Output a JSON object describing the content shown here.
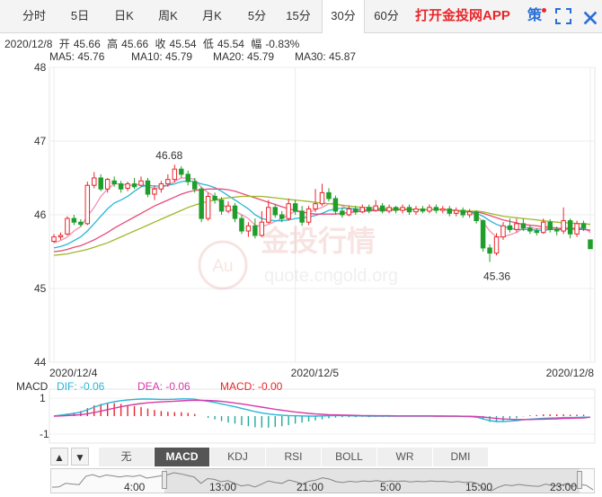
{
  "tabs": [
    {
      "label": "分时"
    },
    {
      "label": "5日"
    },
    {
      "label": "日K"
    },
    {
      "label": "周K"
    },
    {
      "label": "月K"
    },
    {
      "label": "5分"
    },
    {
      "label": "15分"
    },
    {
      "label": "30分",
      "active": true
    },
    {
      "label": "60分"
    }
  ],
  "app_link": "打开金投网APP",
  "strategy_label": "策",
  "fullscreen_icon": "expand-icon",
  "info": {
    "date": "2020/12/8",
    "open_label": "开",
    "open": "45.66",
    "high_label": "高",
    "high": "45.66",
    "close_label": "收",
    "close": "45.54",
    "low_label": "低",
    "low": "45.54",
    "change_label": "幅",
    "change": "-0.83%"
  },
  "ma_legend": [
    {
      "text": "MA5: 45.76",
      "color": "#f48fb1"
    },
    {
      "text": "MA10: 45.79",
      "color": "#29b6d6"
    },
    {
      "text": "MA20: 45.79",
      "color": "#e84c7a"
    },
    {
      "text": "MA30: 45.87",
      "color": "#a0b82a"
    }
  ],
  "watermark": {
    "brand": "金投行情",
    "logo": "Au",
    "url": "quote.cngold.org"
  },
  "macd_legend": {
    "name": "MACD",
    "dif": "DIF: -0.06",
    "dea": "DEA: -0.06",
    "macd": "MACD: -0.00"
  },
  "controls": {
    "prev": "▲",
    "next": "▼"
  },
  "indicators": [
    {
      "label": "无"
    },
    {
      "label": "MACD",
      "active": true
    },
    {
      "label": "KDJ"
    },
    {
      "label": "RSI"
    },
    {
      "label": "BOLL"
    },
    {
      "label": "WR"
    },
    {
      "label": "DMI"
    }
  ],
  "navigator": {
    "ticks": [
      "4:00",
      "13:00",
      "21:00",
      "5:00",
      "15:00",
      "23:00"
    ]
  },
  "colors": {
    "up": "#e8262b",
    "down": "#1f9e2c",
    "dif": "#29b6d6",
    "dea": "#d63aa8"
  },
  "chart_data": {
    "type": "candlestick",
    "title": "",
    "y_axis_ticks": [
      "48",
      "47",
      "46",
      "45",
      "44"
    ],
    "ylim": [
      44,
      48
    ],
    "x_labels": [
      "2020/12/4",
      "2020/12/5",
      "2020/12/8"
    ],
    "annotations": [
      {
        "text": "46.68",
        "kind": "high"
      },
      {
        "text": "45.36",
        "kind": "low"
      }
    ],
    "candles": [
      {
        "o": 45.64,
        "c": 45.7,
        "h": 45.74,
        "l": 45.62
      },
      {
        "o": 45.7,
        "c": 45.72,
        "h": 45.76,
        "l": 45.66
      },
      {
        "o": 45.74,
        "c": 45.95,
        "h": 45.98,
        "l": 45.72
      },
      {
        "o": 45.95,
        "c": 45.9,
        "h": 46.0,
        "l": 45.86
      },
      {
        "o": 45.9,
        "c": 45.87,
        "h": 45.94,
        "l": 45.84
      },
      {
        "o": 45.88,
        "c": 46.4,
        "h": 46.45,
        "l": 45.86
      },
      {
        "o": 46.4,
        "c": 46.5,
        "h": 46.58,
        "l": 46.36
      },
      {
        "o": 46.5,
        "c": 46.35,
        "h": 46.55,
        "l": 46.32
      },
      {
        "o": 46.35,
        "c": 46.48,
        "h": 46.5,
        "l": 46.3
      },
      {
        "o": 46.46,
        "c": 46.42,
        "h": 46.52,
        "l": 46.38
      },
      {
        "o": 46.42,
        "c": 46.35,
        "h": 46.46,
        "l": 46.3
      },
      {
        "o": 46.36,
        "c": 46.42,
        "h": 46.45,
        "l": 46.32
      },
      {
        "o": 46.42,
        "c": 46.38,
        "h": 46.5,
        "l": 46.35
      },
      {
        "o": 46.4,
        "c": 46.46,
        "h": 46.52,
        "l": 46.38
      },
      {
        "o": 46.46,
        "c": 46.28,
        "h": 46.5,
        "l": 46.24
      },
      {
        "o": 46.28,
        "c": 46.35,
        "h": 46.4,
        "l": 46.2
      },
      {
        "o": 46.35,
        "c": 46.42,
        "h": 46.46,
        "l": 46.3
      },
      {
        "o": 46.42,
        "c": 46.48,
        "h": 46.55,
        "l": 46.38
      },
      {
        "o": 46.48,
        "c": 46.62,
        "h": 46.68,
        "l": 46.44
      },
      {
        "o": 46.62,
        "c": 46.55,
        "h": 46.66,
        "l": 46.5
      },
      {
        "o": 46.55,
        "c": 46.45,
        "h": 46.6,
        "l": 46.4
      },
      {
        "o": 46.45,
        "c": 46.35,
        "h": 46.5,
        "l": 46.3
      },
      {
        "o": 46.35,
        "c": 45.95,
        "h": 46.38,
        "l": 45.9
      },
      {
        "o": 45.95,
        "c": 46.25,
        "h": 46.3,
        "l": 45.92
      },
      {
        "o": 46.25,
        "c": 46.2,
        "h": 46.3,
        "l": 46.15
      },
      {
        "o": 46.2,
        "c": 46.05,
        "h": 46.24,
        "l": 46.0
      },
      {
        "o": 46.05,
        "c": 46.12,
        "h": 46.18,
        "l": 46.02
      },
      {
        "o": 46.12,
        "c": 45.95,
        "h": 46.16,
        "l": 45.9
      },
      {
        "o": 45.95,
        "c": 45.78,
        "h": 46.0,
        "l": 45.74
      },
      {
        "o": 45.78,
        "c": 45.85,
        "h": 45.9,
        "l": 45.7
      },
      {
        "o": 45.85,
        "c": 45.72,
        "h": 45.95,
        "l": 45.68
      },
      {
        "o": 45.72,
        "c": 45.9,
        "h": 46.05,
        "l": 45.7
      },
      {
        "o": 45.9,
        "c": 46.1,
        "h": 46.2,
        "l": 45.88
      },
      {
        "o": 46.1,
        "c": 46.0,
        "h": 46.15,
        "l": 45.96
      },
      {
        "o": 46.0,
        "c": 45.95,
        "h": 46.05,
        "l": 45.9
      },
      {
        "o": 45.95,
        "c": 46.15,
        "h": 46.22,
        "l": 45.92
      },
      {
        "o": 46.15,
        "c": 46.05,
        "h": 46.2,
        "l": 46.0
      },
      {
        "o": 46.05,
        "c": 45.9,
        "h": 46.12,
        "l": 45.85
      },
      {
        "o": 45.9,
        "c": 46.08,
        "h": 46.12,
        "l": 45.86
      },
      {
        "o": 46.08,
        "c": 46.15,
        "h": 46.35,
        "l": 46.04
      },
      {
        "o": 46.15,
        "c": 46.3,
        "h": 46.42,
        "l": 46.12
      },
      {
        "o": 46.3,
        "c": 46.22,
        "h": 46.36,
        "l": 46.18
      },
      {
        "o": 46.22,
        "c": 46.05,
        "h": 46.26,
        "l": 46.0
      },
      {
        "o": 46.05,
        "c": 46.0,
        "h": 46.1,
        "l": 45.96
      },
      {
        "o": 46.0,
        "c": 46.08,
        "h": 46.12,
        "l": 45.98
      },
      {
        "o": 46.08,
        "c": 46.04,
        "h": 46.12,
        "l": 46.0
      },
      {
        "o": 46.04,
        "c": 46.1,
        "h": 46.14,
        "l": 46.02
      },
      {
        "o": 46.1,
        "c": 46.06,
        "h": 46.14,
        "l": 46.02
      },
      {
        "o": 46.06,
        "c": 46.12,
        "h": 46.2,
        "l": 46.04
      },
      {
        "o": 46.12,
        "c": 46.05,
        "h": 46.16,
        "l": 46.02
      },
      {
        "o": 46.05,
        "c": 46.1,
        "h": 46.14,
        "l": 46.02
      },
      {
        "o": 46.1,
        "c": 46.06,
        "h": 46.12,
        "l": 46.02
      },
      {
        "o": 46.06,
        "c": 46.1,
        "h": 46.14,
        "l": 46.02
      },
      {
        "o": 46.1,
        "c": 46.04,
        "h": 46.14,
        "l": 46.0
      },
      {
        "o": 46.04,
        "c": 46.08,
        "h": 46.12,
        "l": 46.0
      },
      {
        "o": 46.08,
        "c": 46.05,
        "h": 46.12,
        "l": 46.02
      },
      {
        "o": 46.05,
        "c": 46.1,
        "h": 46.14,
        "l": 46.02
      },
      {
        "o": 46.1,
        "c": 46.06,
        "h": 46.14,
        "l": 46.02
      },
      {
        "o": 46.06,
        "c": 46.08,
        "h": 46.12,
        "l": 46.02
      },
      {
        "o": 46.08,
        "c": 46.02,
        "h": 46.12,
        "l": 45.98
      },
      {
        "o": 46.02,
        "c": 46.06,
        "h": 46.1,
        "l": 45.98
      },
      {
        "o": 46.06,
        "c": 46.0,
        "h": 46.1,
        "l": 45.96
      },
      {
        "o": 46.0,
        "c": 46.04,
        "h": 46.08,
        "l": 45.96
      },
      {
        "o": 46.04,
        "c": 45.92,
        "h": 46.06,
        "l": 45.88
      },
      {
        "o": 45.92,
        "c": 45.55,
        "h": 45.94,
        "l": 45.5
      },
      {
        "o": 45.55,
        "c": 45.48,
        "h": 45.6,
        "l": 45.36
      },
      {
        "o": 45.48,
        "c": 45.7,
        "h": 45.75,
        "l": 45.45
      },
      {
        "o": 45.7,
        "c": 45.85,
        "h": 45.9,
        "l": 45.66
      },
      {
        "o": 45.85,
        "c": 45.8,
        "h": 45.95,
        "l": 45.76
      },
      {
        "o": 45.8,
        "c": 45.88,
        "h": 45.95,
        "l": 45.76
      },
      {
        "o": 45.88,
        "c": 45.82,
        "h": 45.95,
        "l": 45.78
      },
      {
        "o": 45.82,
        "c": 45.78,
        "h": 45.86,
        "l": 45.74
      },
      {
        "o": 45.78,
        "c": 45.76,
        "h": 45.82,
        "l": 45.72
      },
      {
        "o": 45.76,
        "c": 45.9,
        "h": 45.95,
        "l": 45.74
      },
      {
        "o": 45.9,
        "c": 45.8,
        "h": 45.94,
        "l": 45.76
      },
      {
        "o": 45.8,
        "c": 45.78,
        "h": 45.84,
        "l": 45.72
      },
      {
        "o": 45.78,
        "c": 45.92,
        "h": 46.1,
        "l": 45.74
      },
      {
        "o": 45.92,
        "c": 45.74,
        "h": 45.95,
        "l": 45.68
      },
      {
        "o": 45.74,
        "c": 45.88,
        "h": 45.92,
        "l": 45.7
      },
      {
        "o": 45.88,
        "c": 45.82,
        "h": 45.92,
        "l": 45.78
      },
      {
        "o": 45.66,
        "c": 45.54,
        "h": 45.66,
        "l": 45.54
      }
    ],
    "ma_lines": [
      {
        "name": "MA5",
        "values": [
          45.62,
          45.65,
          45.7,
          45.78,
          45.84,
          45.98,
          46.1,
          46.25,
          46.35,
          46.42,
          46.42,
          46.4,
          46.4,
          46.42,
          46.38,
          46.36,
          46.37,
          46.4,
          46.45,
          46.5,
          46.5,
          46.48,
          46.37,
          46.3,
          46.25,
          46.15,
          46.08,
          46.05,
          46.0,
          45.95,
          45.86,
          45.84,
          45.87,
          45.91,
          45.95,
          46.0,
          46.05,
          46.03,
          46.03,
          46.07,
          46.1,
          46.15,
          46.16,
          46.12,
          46.07,
          46.05,
          46.05,
          46.06,
          46.08,
          46.08,
          46.09,
          46.08,
          46.08,
          46.07,
          46.07,
          46.07,
          46.07,
          46.08,
          46.07,
          46.06,
          46.05,
          46.04,
          46.03,
          46.0,
          45.9,
          45.78,
          45.7,
          45.7,
          45.73,
          45.76,
          45.82,
          45.83,
          45.81,
          45.82,
          45.81,
          45.8,
          45.83,
          45.82,
          45.82,
          45.83,
          45.76
        ]
      },
      {
        "name": "MA10",
        "values": [
          45.55,
          45.57,
          45.6,
          45.65,
          45.7,
          45.78,
          45.88,
          45.98,
          46.08,
          46.16,
          46.2,
          46.25,
          46.32,
          46.38,
          46.4,
          46.39,
          46.39,
          46.4,
          46.42,
          46.45,
          46.46,
          46.45,
          46.42,
          46.4,
          46.37,
          46.32,
          46.26,
          46.2,
          46.14,
          46.08,
          46.0,
          45.95,
          45.93,
          45.92,
          45.92,
          45.93,
          45.95,
          45.96,
          45.97,
          45.99,
          46.02,
          46.06,
          46.08,
          46.09,
          46.09,
          46.08,
          46.07,
          46.07,
          46.07,
          46.07,
          46.07,
          46.07,
          46.07,
          46.07,
          46.07,
          46.07,
          46.07,
          46.07,
          46.07,
          46.07,
          46.06,
          46.05,
          46.04,
          46.02,
          45.98,
          45.92,
          45.87,
          45.84,
          45.82,
          45.8,
          45.8,
          45.8,
          45.79,
          45.79,
          45.8,
          45.8,
          45.8,
          45.81,
          45.81,
          45.81,
          45.79
        ]
      },
      {
        "name": "MA20",
        "values": [
          45.5,
          45.51,
          45.53,
          45.56,
          45.58,
          45.62,
          45.66,
          45.71,
          45.76,
          45.82,
          45.87,
          45.92,
          45.97,
          46.02,
          46.07,
          46.12,
          46.16,
          46.2,
          46.24,
          46.28,
          46.31,
          46.33,
          46.34,
          46.35,
          46.35,
          46.35,
          46.34,
          46.32,
          46.29,
          46.26,
          46.23,
          46.2,
          46.17,
          46.14,
          46.11,
          46.08,
          46.06,
          46.04,
          46.02,
          46.01,
          46.01,
          46.01,
          46.01,
          46.02,
          46.03,
          46.04,
          46.05,
          46.05,
          46.06,
          46.06,
          46.06,
          46.07,
          46.07,
          46.07,
          46.07,
          46.07,
          46.07,
          46.07,
          46.07,
          46.07,
          46.06,
          46.06,
          46.05,
          46.04,
          46.02,
          45.99,
          45.96,
          45.93,
          45.91,
          45.89,
          45.87,
          45.86,
          45.85,
          45.84,
          45.83,
          45.82,
          45.81,
          45.81,
          45.8,
          45.8,
          45.79
        ]
      },
      {
        "name": "MA30",
        "values": [
          45.45,
          45.46,
          45.47,
          45.49,
          45.51,
          45.53,
          45.56,
          45.59,
          45.62,
          45.66,
          45.7,
          45.74,
          45.78,
          45.82,
          45.86,
          45.9,
          45.94,
          45.98,
          46.02,
          46.06,
          46.1,
          46.13,
          46.16,
          46.18,
          46.2,
          46.22,
          46.23,
          46.24,
          46.25,
          46.25,
          46.25,
          46.25,
          46.24,
          46.23,
          46.22,
          46.21,
          46.2,
          46.19,
          46.18,
          46.17,
          46.16,
          46.15,
          46.14,
          46.13,
          46.12,
          46.11,
          46.1,
          46.1,
          46.09,
          46.09,
          46.08,
          46.08,
          46.08,
          46.08,
          46.07,
          46.07,
          46.07,
          46.07,
          46.07,
          46.07,
          46.06,
          46.06,
          46.05,
          46.05,
          46.04,
          46.02,
          46.0,
          45.98,
          45.97,
          45.96,
          45.95,
          45.94,
          45.93,
          45.92,
          45.91,
          45.9,
          45.89,
          45.89,
          45.88,
          45.88,
          45.87
        ]
      }
    ],
    "macd": {
      "ylim": [
        -1.5,
        1.5
      ],
      "y_ticks": [
        "1",
        "-1"
      ],
      "dif": [
        0.0,
        0.05,
        0.1,
        0.15,
        0.22,
        0.35,
        0.5,
        0.62,
        0.72,
        0.8,
        0.86,
        0.9,
        0.93,
        0.95,
        0.95,
        0.94,
        0.93,
        0.93,
        0.94,
        0.96,
        0.96,
        0.94,
        0.88,
        0.82,
        0.76,
        0.68,
        0.6,
        0.52,
        0.43,
        0.34,
        0.25,
        0.18,
        0.12,
        0.08,
        0.05,
        0.03,
        0.02,
        0.01,
        0.0,
        0.0,
        0.01,
        0.02,
        0.03,
        0.03,
        0.02,
        0.01,
        0.01,
        0.0,
        0.0,
        0.0,
        0.0,
        0.0,
        0.0,
        0.0,
        0.0,
        0.0,
        0.0,
        0.0,
        0.0,
        -0.01,
        -0.01,
        -0.02,
        -0.03,
        -0.06,
        -0.15,
        -0.25,
        -0.3,
        -0.3,
        -0.28,
        -0.25,
        -0.2,
        -0.17,
        -0.15,
        -0.12,
        -0.11,
        -0.1,
        -0.08,
        -0.08,
        -0.07,
        -0.06,
        -0.06
      ],
      "dea": [
        0.0,
        0.01,
        0.03,
        0.05,
        0.08,
        0.13,
        0.2,
        0.28,
        0.36,
        0.44,
        0.52,
        0.59,
        0.65,
        0.7,
        0.74,
        0.77,
        0.79,
        0.81,
        0.83,
        0.85,
        0.87,
        0.88,
        0.88,
        0.87,
        0.85,
        0.82,
        0.78,
        0.73,
        0.68,
        0.62,
        0.56,
        0.5,
        0.44,
        0.38,
        0.33,
        0.28,
        0.23,
        0.19,
        0.15,
        0.12,
        0.1,
        0.08,
        0.07,
        0.06,
        0.05,
        0.04,
        0.03,
        0.03,
        0.02,
        0.02,
        0.02,
        0.01,
        0.01,
        0.01,
        0.01,
        0.01,
        0.01,
        0.0,
        0.0,
        0.0,
        0.0,
        -0.01,
        -0.01,
        -0.02,
        -0.05,
        -0.09,
        -0.13,
        -0.16,
        -0.18,
        -0.19,
        -0.19,
        -0.19,
        -0.18,
        -0.17,
        -0.16,
        -0.15,
        -0.13,
        -0.12,
        -0.11,
        -0.1,
        -0.06
      ]
    }
  }
}
